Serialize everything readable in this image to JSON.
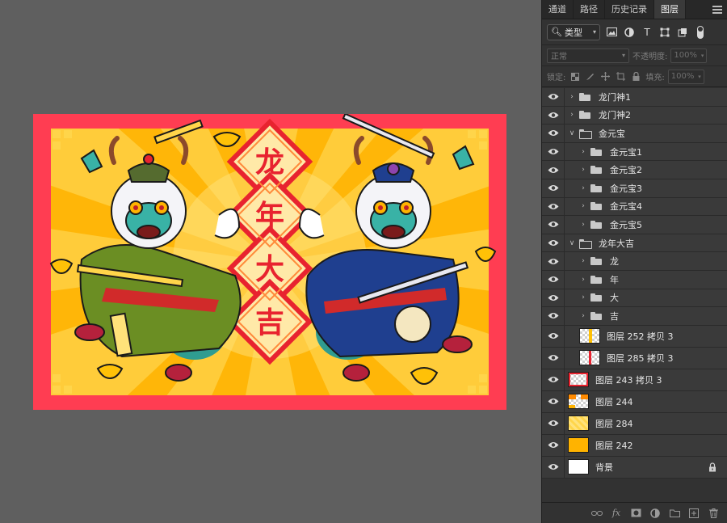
{
  "panel": {
    "tabs": [
      "通道",
      "路径",
      "历史记录",
      "图层"
    ],
    "active_tab": "图层",
    "filter": {
      "label": "类型",
      "icons": [
        "image-icon",
        "adjustment-icon",
        "type-icon",
        "shape-icon",
        "smart-object-icon"
      ]
    },
    "blend_mode": "正常",
    "opacity_label": "不透明度:",
    "opacity_value": "100%",
    "lock_label": "锁定:",
    "fill_label": "填充:",
    "fill_value": "100%"
  },
  "artwork": {
    "title_chars": [
      "龙",
      "年",
      "大",
      "吉"
    ],
    "colors": {
      "frame": "#ff3d52",
      "sunburst": "#ffd54a",
      "ray": "#ffb300",
      "accent_red": "#e8232f",
      "green_robe": "#6b8e23",
      "blue_robe": "#1f3f8f",
      "dragon_teal": "#39b2a6"
    }
  },
  "layers": [
    {
      "name": "龙门神1",
      "type": "group",
      "indent": 0,
      "open": false
    },
    {
      "name": "龙门神2",
      "type": "group",
      "indent": 0,
      "open": false
    },
    {
      "name": "金元宝",
      "type": "group",
      "indent": 0,
      "open": true
    },
    {
      "name": "金元宝1",
      "type": "group",
      "indent": 1,
      "open": false
    },
    {
      "name": "金元宝2",
      "type": "group",
      "indent": 1,
      "open": false
    },
    {
      "name": "金元宝3",
      "type": "group",
      "indent": 1,
      "open": false
    },
    {
      "name": "金元宝4",
      "type": "group",
      "indent": 1,
      "open": false
    },
    {
      "name": "金元宝5",
      "type": "group",
      "indent": 1,
      "open": false
    },
    {
      "name": "龙年大吉",
      "type": "group",
      "indent": 0,
      "open": true
    },
    {
      "name": "龙",
      "type": "group",
      "indent": 1,
      "open": false
    },
    {
      "name": "年",
      "type": "group",
      "indent": 1,
      "open": false
    },
    {
      "name": "大",
      "type": "group",
      "indent": 1,
      "open": false
    },
    {
      "name": "吉",
      "type": "group",
      "indent": 1,
      "open": false
    },
    {
      "name": "图层 252 拷贝 3",
      "type": "pixel",
      "indent": 1,
      "thumb": "strip-yellow"
    },
    {
      "name": "图层 285 拷贝 3",
      "type": "pixel",
      "indent": 1,
      "thumb": "strip-red"
    },
    {
      "name": "图层 243 拷贝 3",
      "type": "pixel",
      "indent": 0,
      "thumb": "frame-red"
    },
    {
      "name": "图层 244",
      "type": "pixel",
      "indent": 0,
      "thumb": "rays-orange"
    },
    {
      "name": "图层 284",
      "type": "pixel",
      "indent": 0,
      "thumb": "pattern-yellow"
    },
    {
      "name": "图层 242",
      "type": "pixel",
      "indent": 0,
      "thumb": "solid-yellow"
    },
    {
      "name": "背景",
      "type": "background",
      "indent": 0,
      "thumb": "solid-white",
      "locked": true
    }
  ],
  "bottom_bar_icons": [
    "link-icon",
    "fx-icon",
    "mask-icon",
    "adjustment-layer-icon",
    "new-group-icon",
    "new-layer-icon",
    "delete-icon"
  ]
}
